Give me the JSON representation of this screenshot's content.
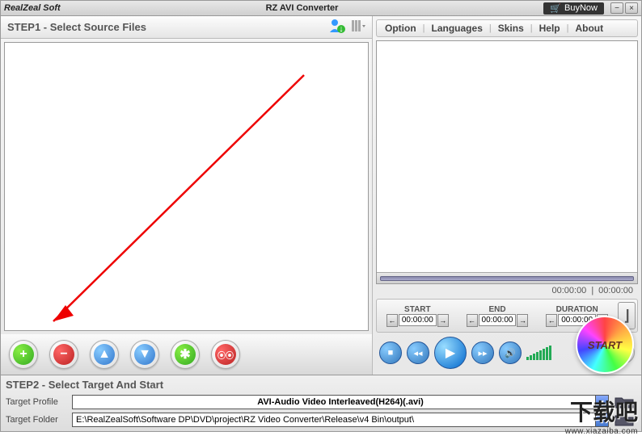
{
  "title": {
    "brand": "RealZeal Soft",
    "app": "RZ AVI Converter",
    "buynow": "BuyNow"
  },
  "menu": {
    "option": "Option",
    "languages": "Languages",
    "skins": "Skins",
    "help": "Help",
    "about": "About"
  },
  "step1": {
    "header": "STEP1 - Select Source Files"
  },
  "time": {
    "elapsed": "00:00:00",
    "total": "00:00:00"
  },
  "trim": {
    "start_lbl": "START",
    "end_lbl": "END",
    "dur_lbl": "DURATION",
    "start": "00:00:00",
    "end": "00:00:00",
    "dur": "00:00:00"
  },
  "start_button": "START",
  "step2": {
    "header": "STEP2 - Select Target And Start",
    "profile_lbl": "Target Profile",
    "folder_lbl": "Target Folder",
    "profile": "AVI-Audio Video Interleaved(H264)(.avi)",
    "folder": "E:\\RealZealSoft\\Software DP\\DVD\\project\\RZ Video Converter\\Release\\v4 Bin\\output\\"
  },
  "watermark": {
    "cn": "下载吧",
    "url": "www.xiazaiba.com"
  }
}
